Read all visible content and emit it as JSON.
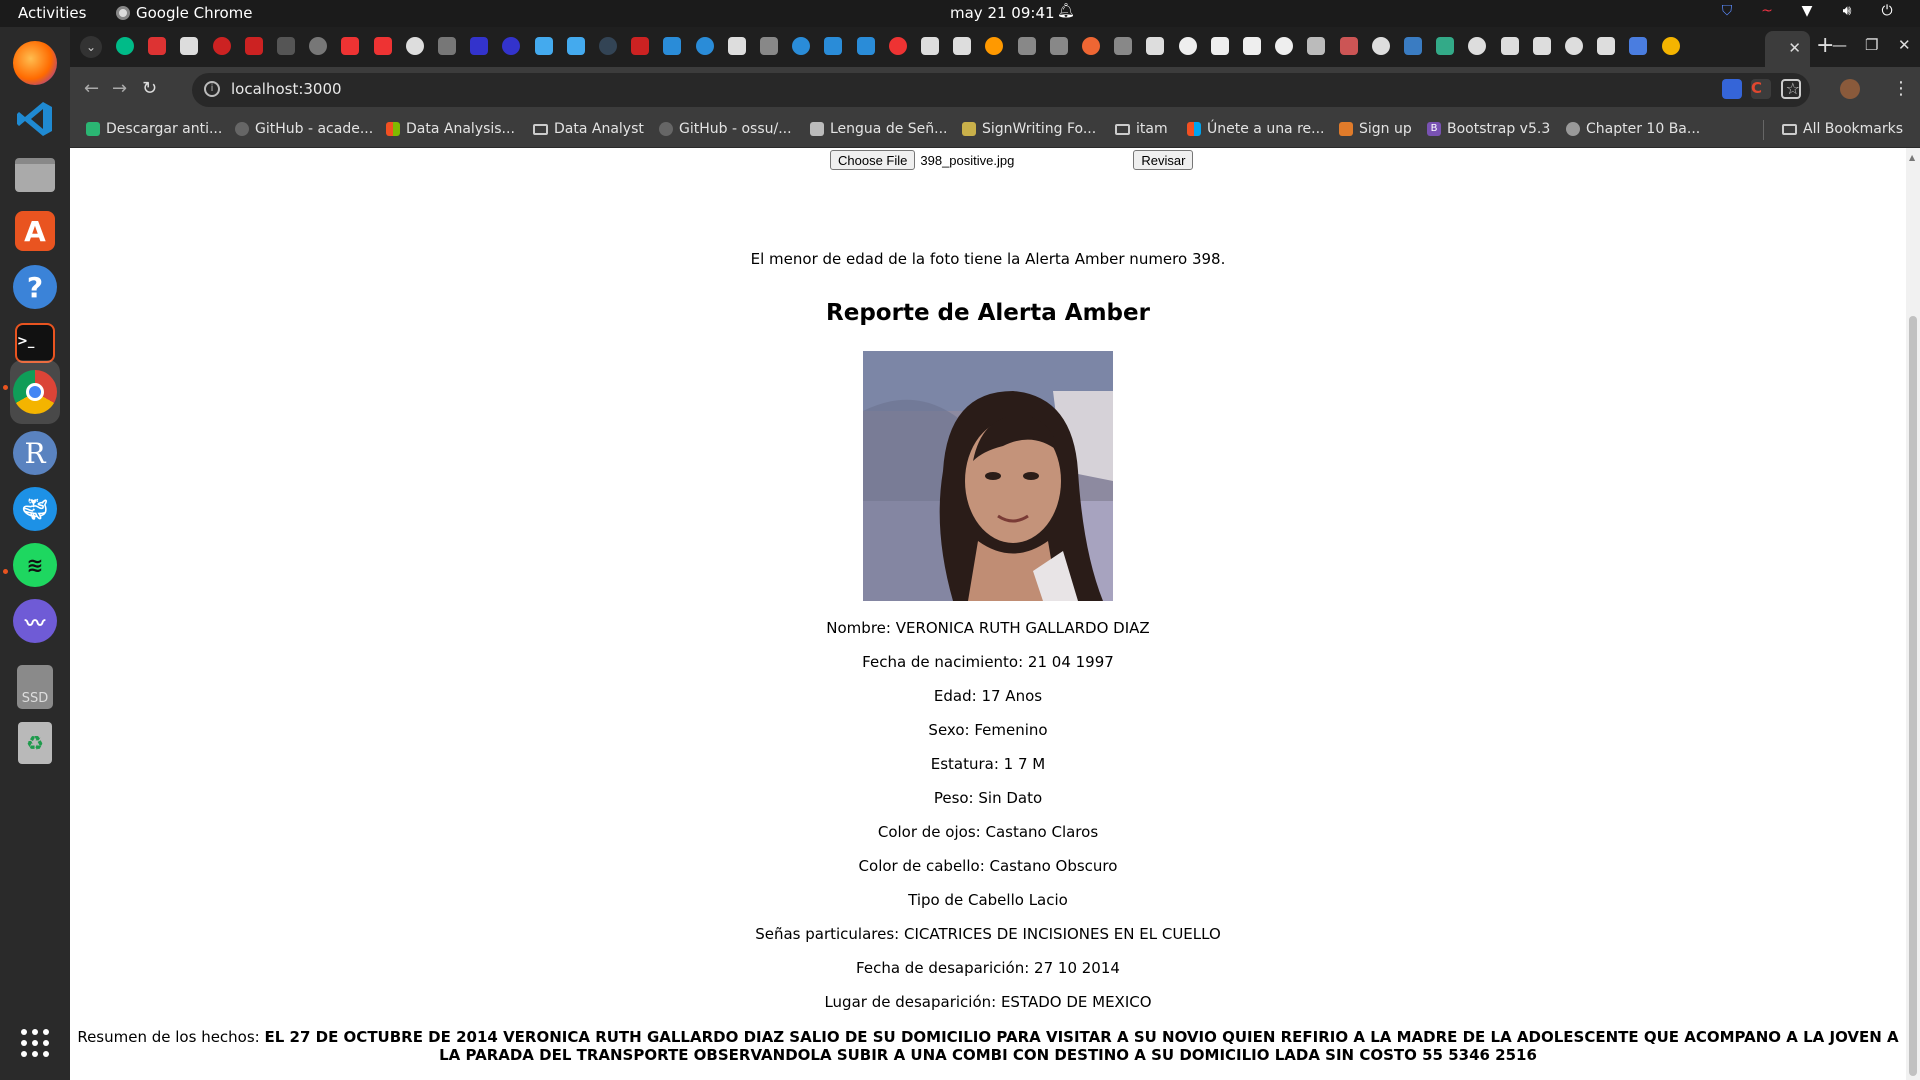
{
  "system_bar": {
    "activities": "Activities",
    "app_name": "Google Chrome",
    "clock": "may 21  09:41"
  },
  "browser": {
    "url": "localhost:3000",
    "bookmarks": [
      "Descargar anti...",
      "GitHub - acade...",
      "Data Analysis...",
      "Data Analyst",
      "GitHub - ossu/...",
      "Lengua de Señ...",
      "SignWriting Fo...",
      "itam",
      "Únete a una re...",
      "Sign up",
      "Bootstrap v5.3",
      "Chapter 10 Ba...",
      "All Bookmarks"
    ]
  },
  "upload": {
    "choose_file_label": "Choose File",
    "file_name": "398_positive.jpg",
    "submit_label": "Revisar"
  },
  "result_message": "El menor de edad de la foto tiene la Alerta Amber numero 398.",
  "report": {
    "title": "Reporte de Alerta Amber",
    "fields": [
      "Nombre: VERONICA RUTH GALLARDO DIAZ",
      "Fecha de nacimiento: 21 04 1997",
      "Edad: 17 Anos",
      "Sexo: Femenino",
      "Estatura: 1 7 M",
      "Peso: Sin Dato",
      "Color de ojos: Castano Claros",
      "Color de cabello: Castano Obscuro",
      "Tipo de Cabello Lacio",
      "Señas particulares: CICATRICES DE INCISIONES EN EL CUELLO",
      "Fecha de desaparición: 27 10 2014",
      "Lugar de desaparición: ESTADO DE MEXICO"
    ],
    "summary_label": "Resumen de los hechos:",
    "summary_text": "EL 27 DE OCTUBRE DE 2014 VERONICA RUTH GALLARDO DIAZ SALIO DE SU DOMICILIO PARA VISITAR A SU NOVIO QUIEN REFIRIO A LA MADRE DE LA ADOLESCENTE QUE ACOMPANO A LA JOVEN A LA PARADA DEL TRANSPORTE OBSERVANDOLA SUBIR A UNA COMBI CON DESTINO A SU DOMICILIO LADA SIN COSTO 55 5346 2516"
  },
  "colors": {
    "chrome_dark": "#3c3c3c",
    "tabstrip": "#1f1f1f",
    "topbar": "#1b1b1b",
    "dock": "#2a2a2a",
    "ubuntu_accent": "#e95420"
  }
}
